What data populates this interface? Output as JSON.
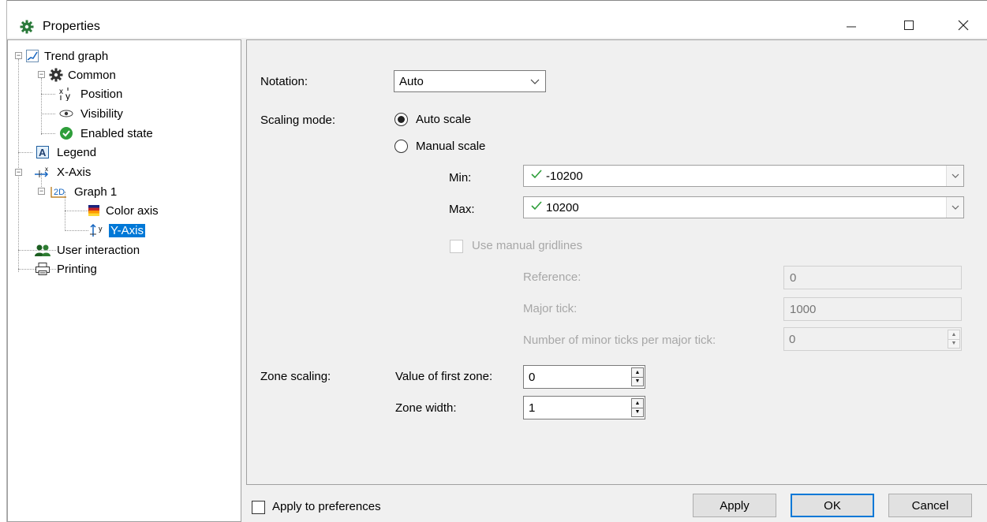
{
  "window": {
    "title": "Properties",
    "icon": "gear-icon"
  },
  "tree": {
    "nodes": [
      {
        "label": "Trend graph",
        "icon": "trend-graph-icon"
      },
      {
        "label": "Common",
        "icon": "gear-icon"
      },
      {
        "label": "Position",
        "icon": "xy-position-icon"
      },
      {
        "label": "Visibility",
        "icon": "eye-icon"
      },
      {
        "label": "Enabled state",
        "icon": "check-circle-icon"
      },
      {
        "label": "Legend",
        "icon": "legend-a-icon"
      },
      {
        "label": "X-Axis",
        "icon": "x-axis-icon"
      },
      {
        "label": "Graph 1",
        "icon": "graph-2d-icon"
      },
      {
        "label": "Color axis",
        "icon": "color-axis-icon"
      },
      {
        "label": "Y-Axis",
        "icon": "y-axis-icon"
      },
      {
        "label": "User interaction",
        "icon": "users-icon"
      },
      {
        "label": "Printing",
        "icon": "printer-icon"
      }
    ],
    "selected": "Y-Axis"
  },
  "form": {
    "notation_label": "Notation:",
    "notation_value": "Auto",
    "scaling_mode_label": "Scaling mode:",
    "auto_scale_label": "Auto scale",
    "manual_scale_label": "Manual scale",
    "scaling_mode_selected": "Auto scale",
    "min_label": "Min:",
    "min_value": "-10200",
    "max_label": "Max:",
    "max_value": "10200",
    "use_manual_gridlines_label": "Use manual gridlines",
    "reference_label": "Reference:",
    "reference_value": "0",
    "major_tick_label": "Major tick:",
    "major_tick_value": "1000",
    "minor_ticks_label": "Number of minor ticks per major tick:",
    "minor_ticks_value": "0",
    "zone_scaling_label": "Zone scaling:",
    "first_zone_label": "Value of first zone:",
    "first_zone_value": "0",
    "zone_width_label": "Zone width:",
    "zone_width_value": "1"
  },
  "footer": {
    "apply_prefs_label": "Apply to preferences",
    "apply_label": "Apply",
    "ok_label": "OK",
    "cancel_label": "Cancel"
  },
  "colors": {
    "selection": "#0078d7",
    "check_green": "#2e9e3a",
    "gear_green": "#2a7a3a"
  }
}
